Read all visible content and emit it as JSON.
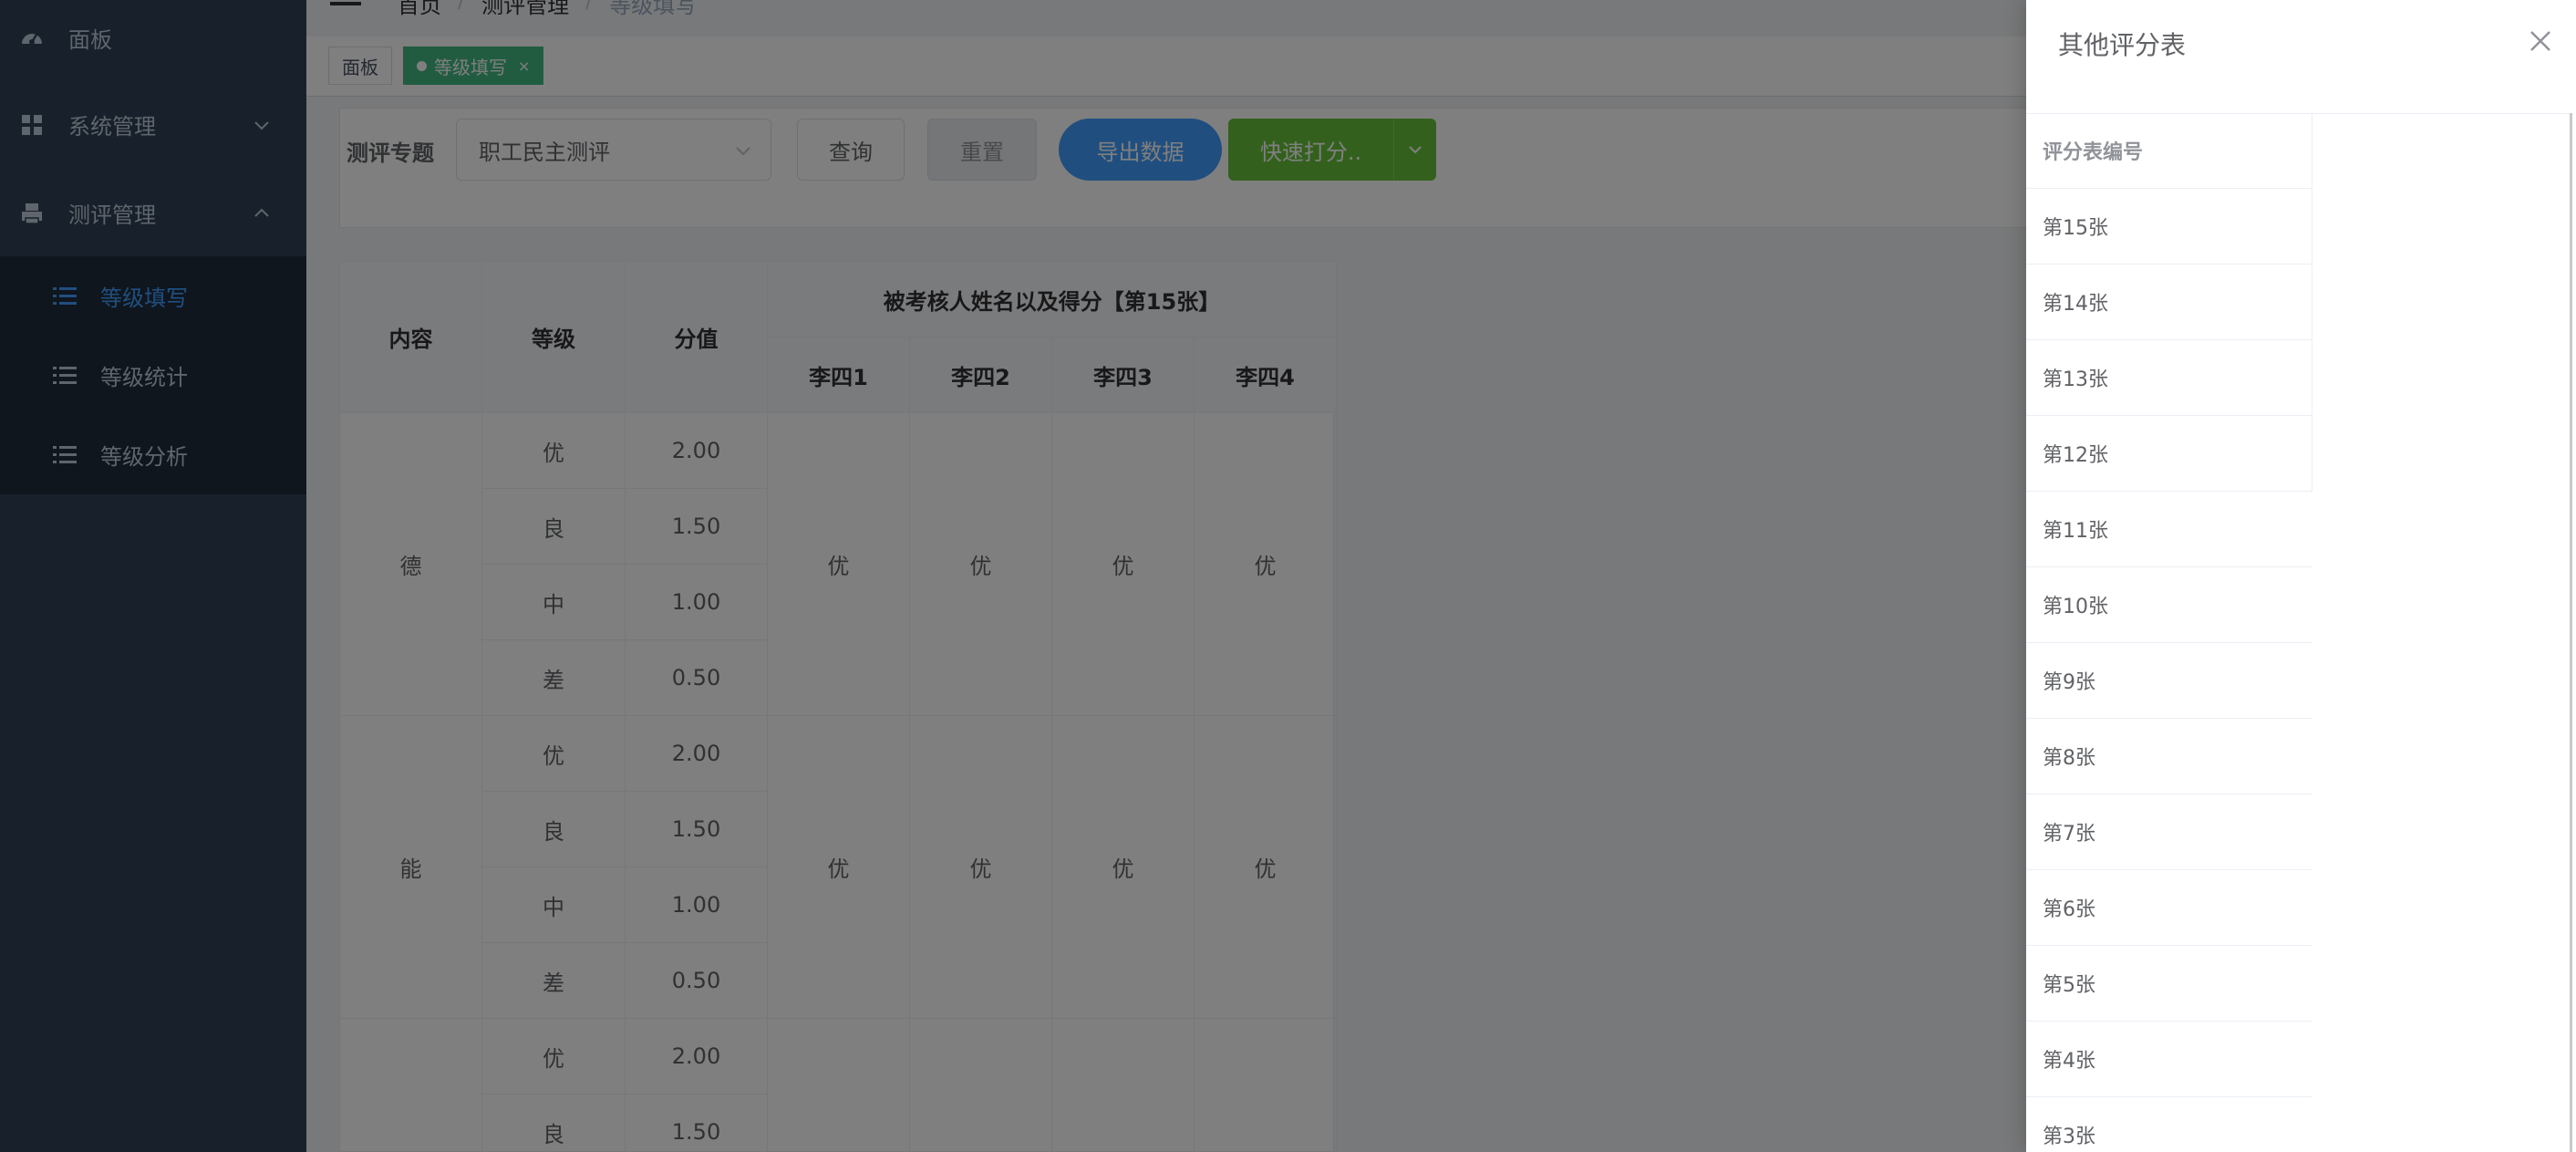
{
  "sidebar": {
    "items": [
      {
        "label": "面板",
        "icon": "dashboard-icon"
      },
      {
        "label": "系统管理",
        "icon": "grid-icon"
      },
      {
        "label": "测评管理",
        "icon": "printer-icon"
      }
    ],
    "subitems": [
      {
        "label": "等级填写",
        "icon": "list-icon",
        "active": true
      },
      {
        "label": "等级统计",
        "icon": "list-icon",
        "active": false
      },
      {
        "label": "等级分析",
        "icon": "list-icon",
        "active": false
      }
    ]
  },
  "breadcrumb": [
    "首页",
    "测评管理",
    "等级填写"
  ],
  "tags": [
    "面板",
    "等级填写"
  ],
  "filter": {
    "label": "测评专题",
    "select_value": "职工民主测评",
    "query_label": "查询",
    "reset_label": "重置",
    "export_label": "导出数据",
    "quick_label": "快速打分.."
  },
  "table": {
    "headers": {
      "content": "内容",
      "level": "等级",
      "score": "分值",
      "group": "被考核人姓名以及得分【第15张】",
      "persons": [
        "李四1",
        "李四2",
        "李四3",
        "李四4"
      ]
    },
    "sections": [
      {
        "content": "德",
        "rows": [
          {
            "level": "优",
            "score": "2.00"
          },
          {
            "level": "良",
            "score": "1.50"
          },
          {
            "level": "中",
            "score": "1.00"
          },
          {
            "level": "差",
            "score": "0.50"
          }
        ],
        "grades": [
          "优",
          "优",
          "优",
          "优"
        ]
      },
      {
        "content": "能",
        "rows": [
          {
            "level": "优",
            "score": "2.00"
          },
          {
            "level": "良",
            "score": "1.50"
          },
          {
            "level": "中",
            "score": "1.00"
          },
          {
            "level": "差",
            "score": "0.50"
          }
        ],
        "grades": [
          "优",
          "优",
          "优",
          "优"
        ]
      },
      {
        "content": "",
        "rows": [
          {
            "level": "优",
            "score": "2.00"
          },
          {
            "level": "良",
            "score": "1.50"
          }
        ],
        "grades": [
          "",
          "",
          "",
          ""
        ]
      }
    ]
  },
  "drawer": {
    "title": "其他评分表",
    "column": "评分表编号",
    "rows": [
      "第15张",
      "第14张",
      "第13张",
      "第12张",
      "第11张",
      "第10张",
      "第9张",
      "第8张",
      "第7张",
      "第6张",
      "第5张",
      "第4张",
      "第3张"
    ]
  },
  "colors": {
    "sidebar": "#304156",
    "submenu": "#1f2d3d",
    "active_tag": "#42b983",
    "primary": "#409eff",
    "success": "#67c23a"
  }
}
